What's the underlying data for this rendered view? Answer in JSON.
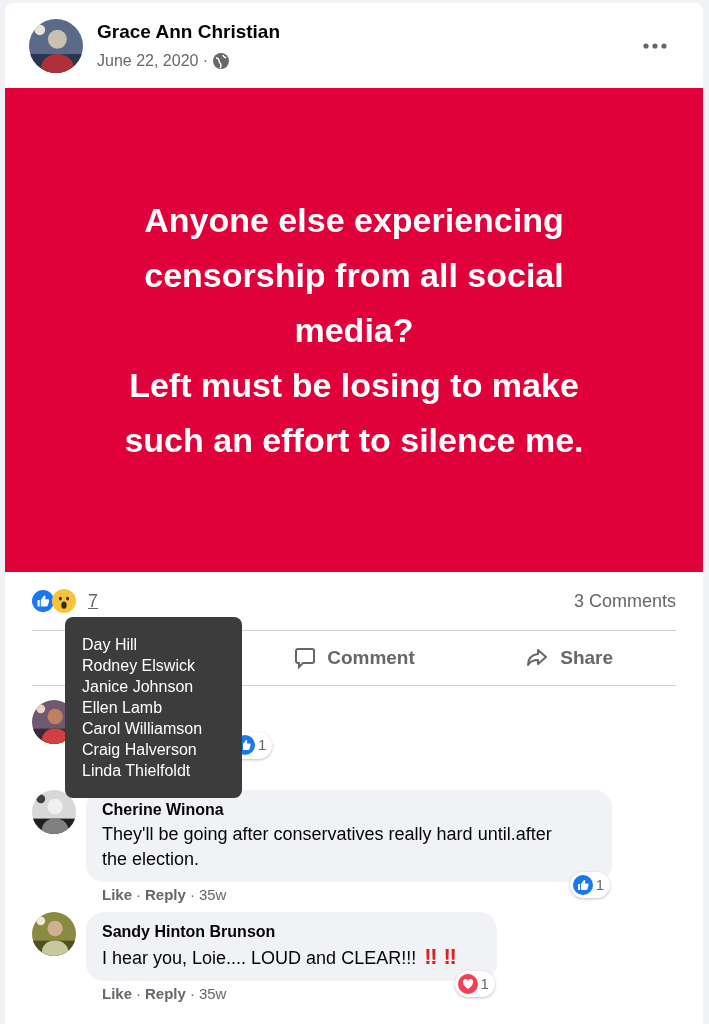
{
  "post": {
    "author": "Grace Ann Christian",
    "date": "June 22, 2020 ·",
    "image_text": [
      "Anyone else experiencing censorship from all social media?",
      "Left must be losing to make such an effort to silence me."
    ],
    "reaction_count": "7",
    "comments_count": "3 Comments"
  },
  "actions": [
    {
      "kind": "comment",
      "label": "Comment"
    },
    {
      "kind": "share",
      "label": "Share"
    }
  ],
  "tooltip": {
    "names": [
      "Day Hill",
      "Rodney Elswick",
      "Janice Johnson",
      "Ellen Lamb",
      "Carol Williamson",
      "Craig Halverson",
      "Linda Thielfoldt"
    ]
  },
  "comments": [
    {
      "kind": "covered",
      "badge": {
        "kind": "like",
        "count": "1"
      }
    },
    {
      "kind": "full",
      "author": "Cherine Winona",
      "text": "They'll be going after conservatives really hard until.after the election.",
      "meta": [
        "Like",
        "·",
        "Reply",
        "·",
        "35w"
      ],
      "badge": {
        "kind": "like",
        "count": "1"
      }
    },
    {
      "kind": "full",
      "author": "Sandy Hinton Brunson",
      "text": "I hear you, Loie.... LOUD and CLEAR!!!",
      "emoji": "‼ ‼",
      "meta": [
        "Like",
        "·",
        "Reply",
        "·",
        "35w"
      ],
      "badge": {
        "kind": "love",
        "count": "1"
      }
    }
  ]
}
